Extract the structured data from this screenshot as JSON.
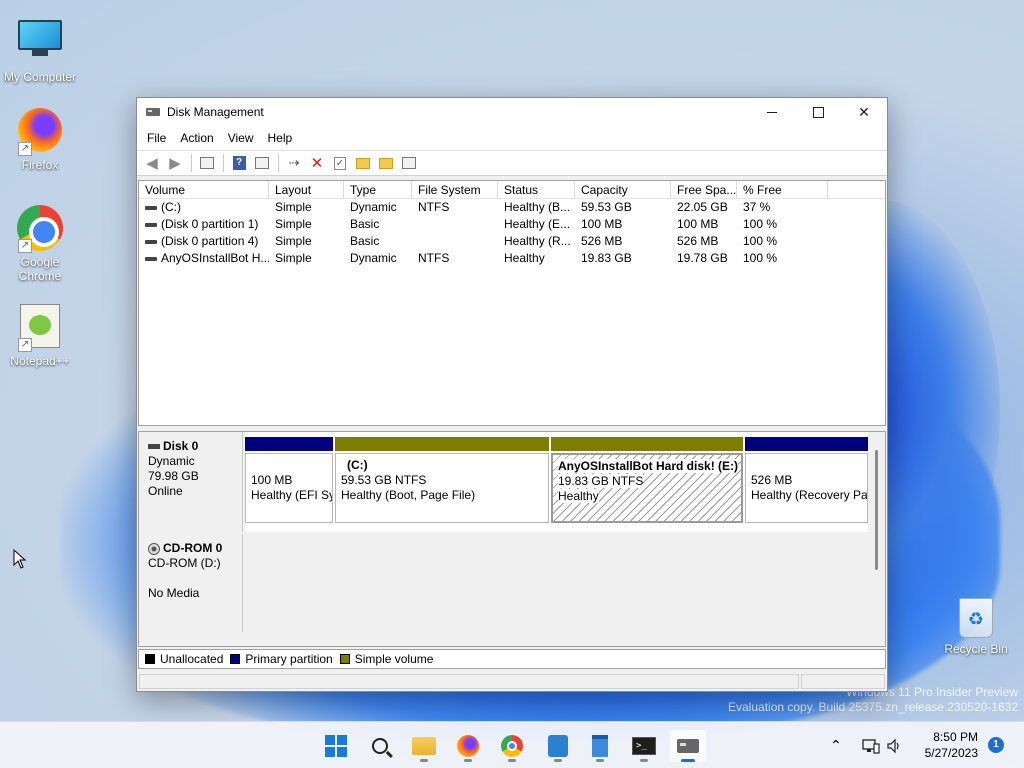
{
  "desktop": {
    "icons": [
      {
        "label": "My Computer"
      },
      {
        "label": "Firefox"
      },
      {
        "label": "Google Chrome"
      },
      {
        "label": "Notepad++"
      }
    ],
    "recycle_bin": {
      "label": "Recycle Bin"
    },
    "watermark": {
      "line1": "Windows 11 Pro Insider Preview",
      "line2": "Evaluation copy. Build 25375.zn_release.230520-1632"
    }
  },
  "window": {
    "title": "Disk Management",
    "menu": [
      "File",
      "Action",
      "View",
      "Help"
    ],
    "columns": [
      "Volume",
      "Layout",
      "Type",
      "File System",
      "Status",
      "Capacity",
      "Free Spa...",
      "% Free"
    ],
    "volumes": [
      {
        "volume": "(C:)",
        "layout": "Simple",
        "type": "Dynamic",
        "fs": "NTFS",
        "status": "Healthy (B...",
        "capacity": "59.53 GB",
        "free": "22.05 GB",
        "pct": "37 %"
      },
      {
        "volume": "(Disk 0 partition 1)",
        "layout": "Simple",
        "type": "Basic",
        "fs": "",
        "status": "Healthy (E...",
        "capacity": "100 MB",
        "free": "100 MB",
        "pct": "100 %"
      },
      {
        "volume": "(Disk 0 partition 4)",
        "layout": "Simple",
        "type": "Basic",
        "fs": "",
        "status": "Healthy (R...",
        "capacity": "526 MB",
        "free": "526 MB",
        "pct": "100 %"
      },
      {
        "volume": "AnyOSInstallBot H...",
        "layout": "Simple",
        "type": "Dynamic",
        "fs": "NTFS",
        "status": "Healthy",
        "capacity": "19.83 GB",
        "free": "19.78 GB",
        "pct": "100 %"
      }
    ],
    "disk0": {
      "name": "Disk 0",
      "type": "Dynamic",
      "size": "79.98 GB",
      "state": "Online",
      "partitions": [
        {
          "title": "",
          "size": "100 MB",
          "status": "Healthy (EFI Sy"
        },
        {
          "title": "(C:)",
          "size": "59.53 GB NTFS",
          "status": "Healthy (Boot, Page File)"
        },
        {
          "title": "AnyOSInstallBot Hard disk!  (E:)",
          "size": "19.83 GB NTFS",
          "status": "Healthy"
        },
        {
          "title": "",
          "size": "526 MB",
          "status": "Healthy (Recovery Pa"
        }
      ]
    },
    "cdrom0": {
      "name": "CD-ROM 0",
      "drive": "CD-ROM (D:)",
      "media": "No Media"
    },
    "legend": [
      {
        "label": "Unallocated",
        "color": "#000000"
      },
      {
        "label": "Primary partition",
        "color": "#00007d"
      },
      {
        "label": "Simple volume",
        "color": "#7d7d00"
      }
    ]
  },
  "taskbar": {
    "clock_time": "8:50 PM",
    "clock_date": "5/27/2023",
    "notification_count": "1"
  }
}
